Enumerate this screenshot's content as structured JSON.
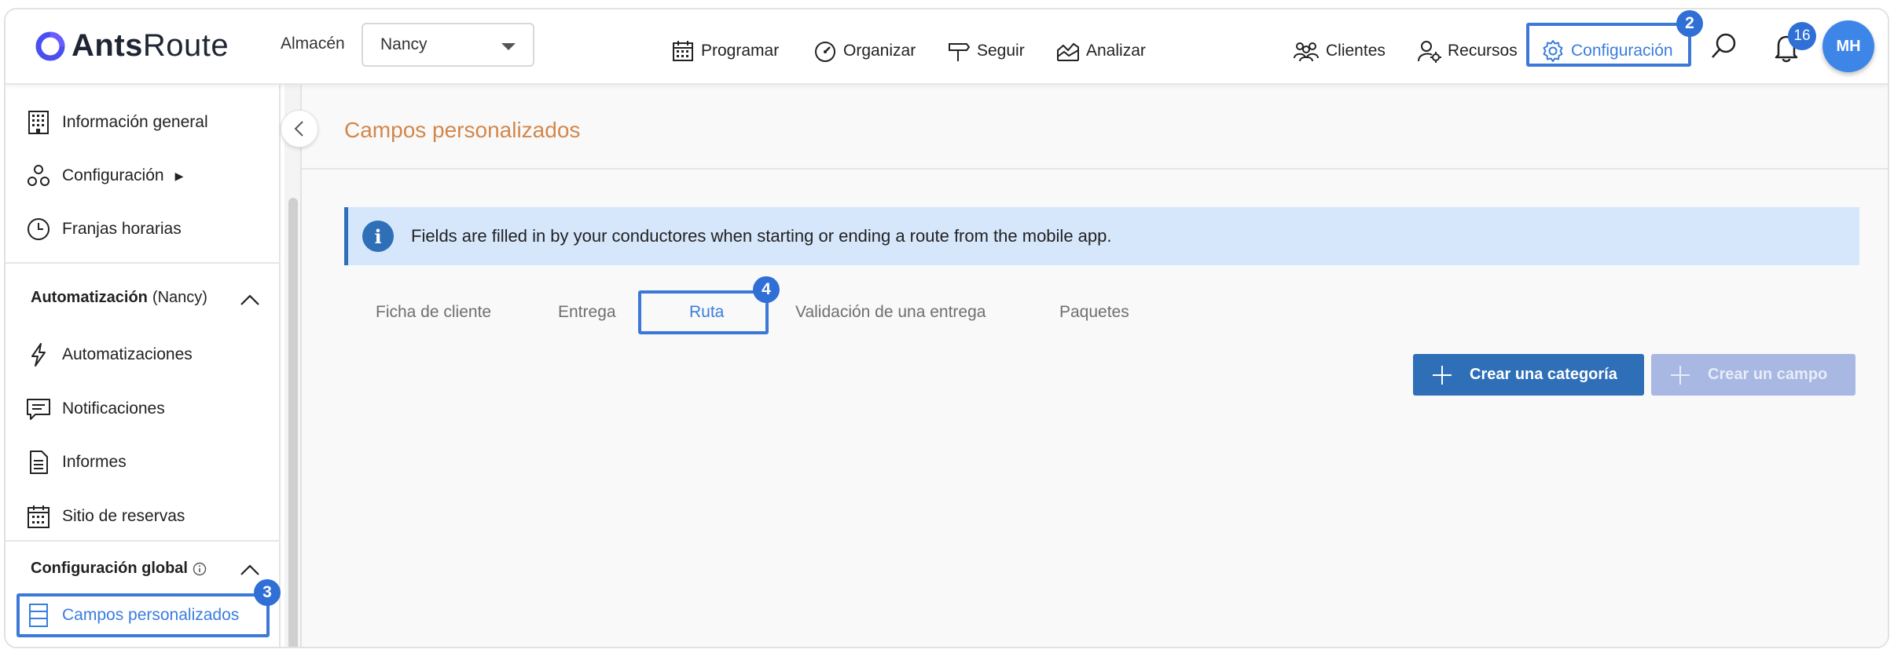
{
  "app": {
    "name_bold": "Ants",
    "name_regular": "Route"
  },
  "header": {
    "warehouse_label": "Almacén",
    "warehouse_value": "Nancy",
    "nav": {
      "programar": "Programar",
      "organizar": "Organizar",
      "seguir": "Seguir",
      "analizar": "Analizar",
      "clientes": "Clientes",
      "recursos": "Recursos",
      "configuracion": "Configuración"
    },
    "notification_count": "16",
    "avatar_initials": "MH"
  },
  "sidebar": {
    "items_top": [
      "Información general",
      "Configuración",
      "Franjas horarias"
    ],
    "config_arrow": "▶",
    "section_auto": {
      "title": "Automatización",
      "suffix": "(Nancy)"
    },
    "items_auto": [
      "Automatizaciones",
      "Notificaciones",
      "Informes",
      "Sitio de reservas"
    ],
    "section_global": {
      "title": "Configuración global"
    },
    "active_item": "Campos personalizados"
  },
  "main": {
    "title": "Campos personalizados",
    "info_text": "Fields are filled in by your conductores when starting or ending a route from the mobile app.",
    "tabs": [
      "Ficha de cliente",
      "Entrega",
      "Ruta",
      "Validación de una entrega",
      "Paquetes"
    ],
    "active_tab": "Ruta",
    "buttons": {
      "create_category": "Crear una categoría",
      "create_field": "Crear un campo"
    }
  },
  "annotations": {
    "step_config": "2",
    "step_campos": "3",
    "step_ruta": "4"
  },
  "colors": {
    "accent": "#3a7ddd",
    "primary": "#2f6fb8",
    "title": "#d2874a",
    "banner": "#d6e6fb",
    "highlight": "#3c78d8"
  }
}
